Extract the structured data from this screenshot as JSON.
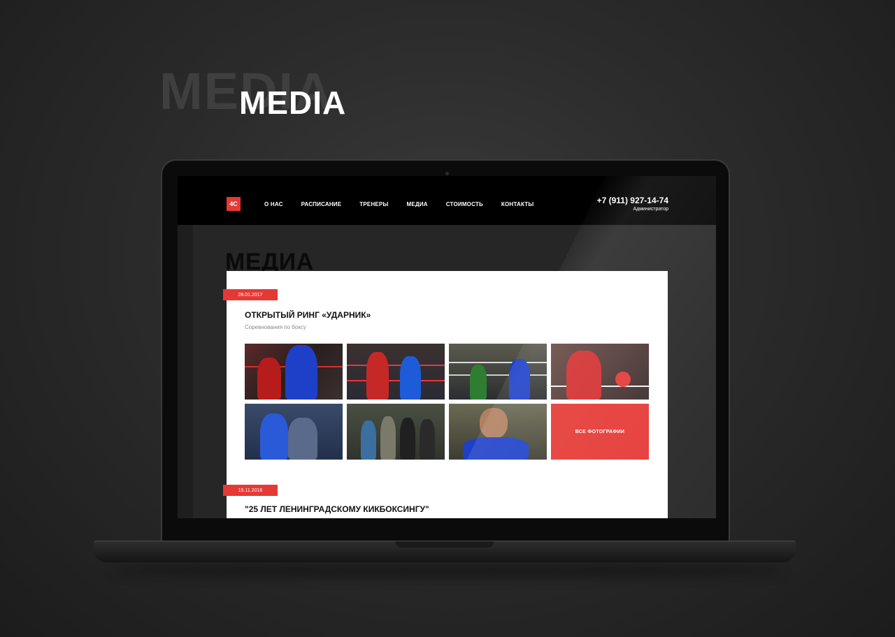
{
  "hero": {
    "shadow_text": "MEDIA",
    "title": "MEDIA"
  },
  "site": {
    "logo": "4C",
    "nav": [
      "О НАС",
      "РАСПИСАНИЕ",
      "ТРЕНЕРЫ",
      "МЕДИА",
      "СТОИМОСТЬ",
      "КОНТАКТЫ"
    ],
    "phone": "+7 (911) 927-14-74",
    "phone_caption": "Администратор",
    "page_title": "МЕДИА"
  },
  "events": [
    {
      "date": "28.01.2017",
      "title": "ОТКРЫТЫЙ РИНГ «УДАРНИК»",
      "subtitle": "Соревнования по боксу"
    },
    {
      "date": "15.11.2016",
      "title": "\"25 ЛЕТ ЛЕНИНГРАДСКОМУ КИКБОКСИНГУ\""
    }
  ],
  "gallery": {
    "all_photos_label": "ВСЕ ФОТОГРАФИИ"
  },
  "colors": {
    "accent": "#e53935",
    "background": "#2b2b2b",
    "header": "#000000",
    "card": "#ffffff"
  }
}
